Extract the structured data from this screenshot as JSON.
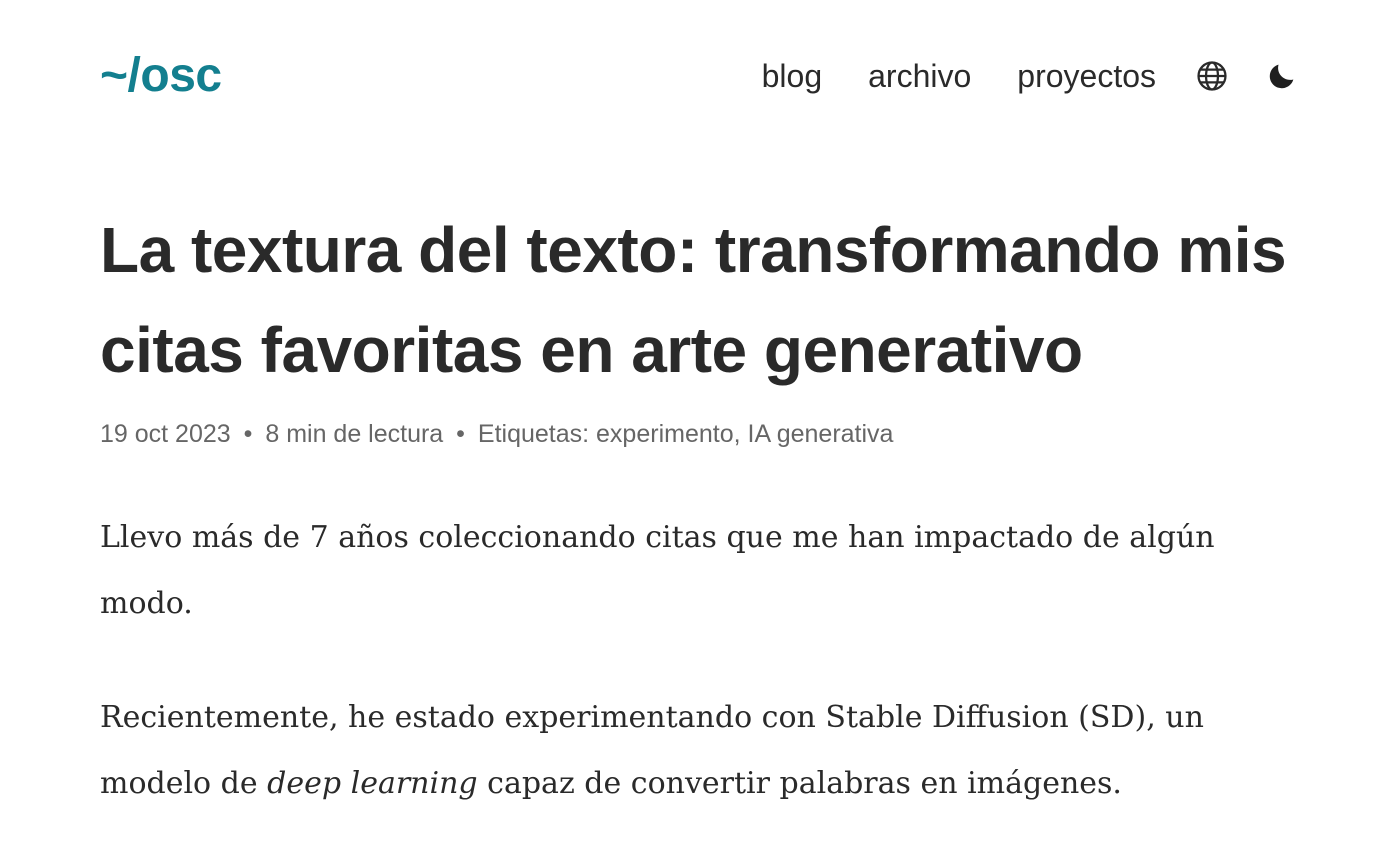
{
  "header": {
    "logo": "~/osc",
    "nav": [
      {
        "label": "blog"
      },
      {
        "label": "archivo"
      },
      {
        "label": "proyectos"
      }
    ],
    "icons": {
      "language": "globe-icon",
      "theme": "moon-icon"
    }
  },
  "article": {
    "title": "La textura del texto: transformando mis citas favoritas en arte generativo",
    "date": "19 oct 2023",
    "reading_time": "8 min de lectura",
    "tags_label": "Etiquetas:",
    "tags": [
      "experimento",
      "IA generativa"
    ],
    "tag_separator": ",",
    "separator": "•",
    "paragraph1": "Llevo más de 7 años coleccionando citas que me han impactado de algún modo.",
    "paragraph2_before": "Recientemente, he estado experimentando con Stable Diffusion (SD), un modelo de ",
    "paragraph2_em": "deep learning",
    "paragraph2_after": " capaz de convertir palabras en imágenes."
  },
  "colors": {
    "accent": "#137f8f",
    "text": "#2a2a2a",
    "muted": "#666666",
    "background": "#ffffff"
  }
}
